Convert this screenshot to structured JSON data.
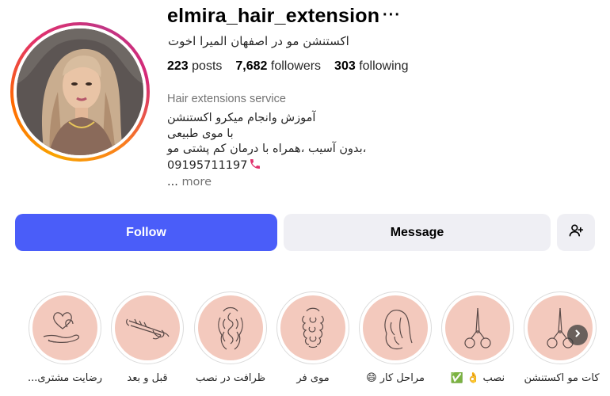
{
  "profile": {
    "username": "elmira_hair_extension",
    "more_icon": "more-dots-icon",
    "full_name": "اکستنشن مو در اصفهان المیرا اخوت",
    "stats": {
      "posts_count": "223",
      "posts_label": "posts",
      "followers_count": "7,682",
      "followers_label": "followers",
      "following_count": "303",
      "following_label": "following"
    },
    "category": "Hair extensions service",
    "bio_lines": [
      "آموزش وانجام میکرو اکستنشن",
      "با موی طبیعی",
      "،بدون آسیب ،همراه با درمان کم پشتی مو",
      "09195711197"
    ],
    "bio_more_dots": "...",
    "bio_more_label": "more"
  },
  "actions": {
    "follow_label": "Follow",
    "message_label": "Message",
    "add_user_icon": "add-user-icon"
  },
  "highlights": [
    {
      "label": "رضایت مشتری...",
      "icon": "hearts-hand-icon"
    },
    {
      "label": "قبل و بعد",
      "icon": "curling-iron-icon"
    },
    {
      "label": "ظرافت در نصب",
      "icon": "braid-back-icon"
    },
    {
      "label": "موی فر",
      "icon": "curly-hair-icon"
    },
    {
      "label": "مراحل کار 😄",
      "icon": "hair-portrait-icon"
    },
    {
      "label": "نصب 👌 ✅",
      "icon": "scissors-icon"
    },
    {
      "label": "کات مو اکستنشن",
      "icon": "scissors-icon"
    }
  ],
  "colors": {
    "follow_button": "#4a5df9",
    "secondary_button": "#efeff4",
    "highlight_fill": "#f3c9bd",
    "muted_text": "#737373"
  }
}
